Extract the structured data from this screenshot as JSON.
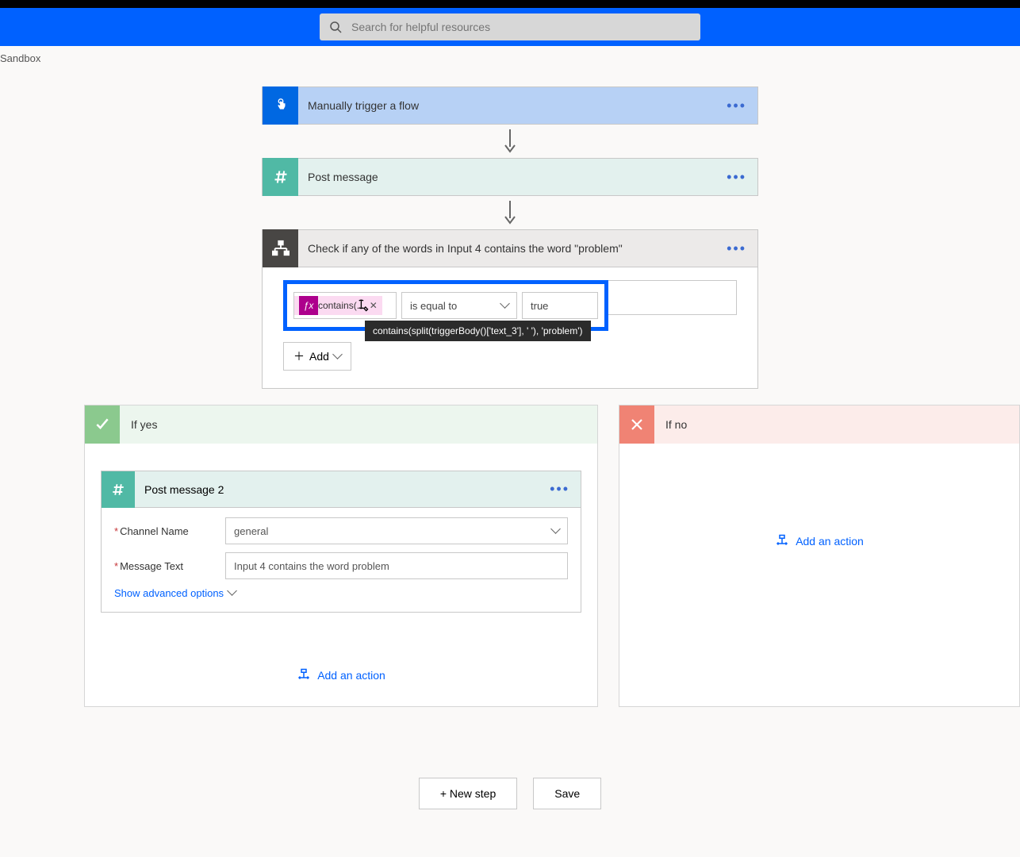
{
  "search": {
    "placeholder": "Search for helpful resources"
  },
  "breadcrumb": "Sandbox",
  "trigger": {
    "title": "Manually trigger a flow"
  },
  "postMessage": {
    "title": "Post message"
  },
  "condition": {
    "title": "Check if any of the words in Input 4 contains the word \"problem\"",
    "expression_label": "contains(...",
    "operator": "is equal to",
    "value": "true",
    "tooltip": "contains(split(triggerBody()['text_3'], ' '), 'problem')",
    "add_label": "Add"
  },
  "branches": {
    "yes": {
      "title": "If yes",
      "post2": {
        "title": "Post message 2",
        "channel_label": "Channel Name",
        "channel_value": "general",
        "message_label": "Message Text",
        "message_value": "Input 4 contains the word problem",
        "advanced": "Show advanced options"
      },
      "add_action": "Add an action"
    },
    "no": {
      "title": "If no",
      "add_action": "Add an action"
    }
  },
  "footer": {
    "new_step": "+ New step",
    "save": "Save"
  }
}
